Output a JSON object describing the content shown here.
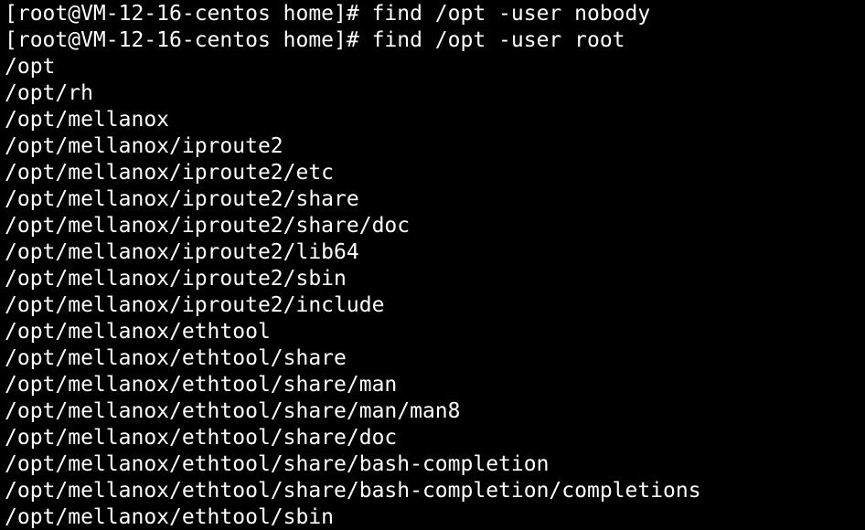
{
  "terminal": {
    "background": "#000000",
    "foreground": "#ffffff",
    "lines": [
      "[root@VM-12-16-centos home]# find /opt -user nobody",
      "[root@VM-12-16-centos home]# find /opt -user root",
      "/opt",
      "/opt/rh",
      "/opt/mellanox",
      "/opt/mellanox/iproute2",
      "/opt/mellanox/iproute2/etc",
      "/opt/mellanox/iproute2/share",
      "/opt/mellanox/iproute2/share/doc",
      "/opt/mellanox/iproute2/lib64",
      "/opt/mellanox/iproute2/sbin",
      "/opt/mellanox/iproute2/include",
      "/opt/mellanox/ethtool",
      "/opt/mellanox/ethtool/share",
      "/opt/mellanox/ethtool/share/man",
      "/opt/mellanox/ethtool/share/man/man8",
      "/opt/mellanox/ethtool/share/doc",
      "/opt/mellanox/ethtool/share/bash-completion",
      "/opt/mellanox/ethtool/share/bash-completion/completions",
      "/opt/mellanox/ethtool/sbin"
    ]
  }
}
